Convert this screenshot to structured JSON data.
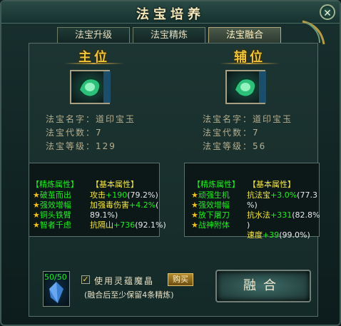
{
  "window": {
    "title": "法宝培养",
    "close_glyph": "✕"
  },
  "tabs": [
    {
      "label": "法宝升级"
    },
    {
      "label": "法宝精炼"
    },
    {
      "label": "法宝融合"
    }
  ],
  "main": {
    "label": "主位",
    "name_row": "法宝名字：道印宝玉",
    "gen_row": "法宝代数：7",
    "level_row": "法宝等级：129",
    "refine_header": "【精炼属性】",
    "refine": [
      "破茧而出",
      "强效增幅",
      "铜头铁臂",
      "智者千虑"
    ],
    "base_header": "【基本属性】",
    "base": [
      {
        "name": "攻击",
        "bonus": "+190",
        "pct": "(79.2%)"
      },
      {
        "name": "加强毒伤害",
        "bonus": "+4.2%",
        "pct": "(",
        "wrap": "89.1%)"
      },
      {
        "name": "抗隔山",
        "bonus": "+736",
        "pct": "(92.1%)"
      }
    ]
  },
  "aux": {
    "label": "辅位",
    "name_row": "法宝名字：道印宝玉",
    "gen_row": "法宝代数：7",
    "level_row": "法宝等级：56",
    "refine_header": "【精炼属性】",
    "refine": [
      "顽强生机",
      "强效增幅",
      "放下屠刀",
      "战神附体"
    ],
    "base_header": "【基本属性】",
    "base": [
      {
        "name": "抗法宝",
        "bonus": "+3.0%",
        "pct": "(77.3",
        "wrap": "%)"
      },
      {
        "name": "抗水法",
        "bonus": "+331",
        "pct": "(82.8%",
        "wrap": ")"
      },
      {
        "name": "速度",
        "bonus": "+39",
        "pct": "(99.0%)"
      }
    ]
  },
  "footer": {
    "gem_count": "50/50",
    "use_label": "使用灵蕴魔晶",
    "buy_label": "购买",
    "hint": "(融合后至少保留4条精炼)",
    "fuse_label": "融合",
    "checkbox_mark": "✓"
  },
  "colors": {
    "accent_gold": "#f3c63a",
    "refine_green": "#22ee22",
    "base_yellow": "#f4e64a"
  }
}
